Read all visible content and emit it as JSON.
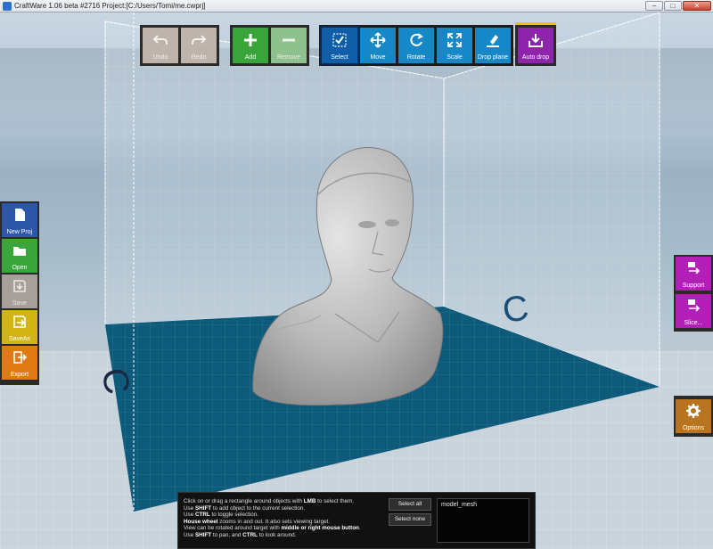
{
  "window": {
    "title": "CraftWare 1.06 beta #2716   Project:[C:/Users/Tomi/me.cwprj]",
    "min": "–",
    "max": "□",
    "close": "✕"
  },
  "toolbar": {
    "history": [
      {
        "label": "Undo",
        "icon": "undo-icon"
      },
      {
        "label": "Redo",
        "icon": "redo-icon"
      }
    ],
    "objects": [
      {
        "label": "Add",
        "icon": "plus-icon"
      },
      {
        "label": "Remove",
        "icon": "minus-icon"
      }
    ],
    "transform": [
      {
        "label": "Select",
        "icon": "select-check-icon",
        "active": true
      },
      {
        "label": "Move",
        "icon": "move-arrows-icon"
      },
      {
        "label": "Rotate",
        "icon": "rotate-icon"
      },
      {
        "label": "Scale",
        "icon": "scale-icon"
      },
      {
        "label": "Drop plane",
        "icon": "drop-plane-icon"
      }
    ],
    "auto_drop": {
      "label": "Auto drop",
      "icon": "auto-drop-icon"
    }
  },
  "left_panel": [
    {
      "label": "New Proj",
      "icon": "new-project-icon"
    },
    {
      "label": "Open",
      "icon": "folder-icon"
    },
    {
      "label": "Save",
      "icon": "save-icon"
    },
    {
      "label": "SaveAs",
      "icon": "save-as-icon"
    },
    {
      "label": "Export",
      "icon": "export-icon"
    }
  ],
  "right_panel": [
    {
      "label": "Support",
      "icon": "support-icon"
    },
    {
      "label": "Slice...",
      "icon": "slice-icon"
    }
  ],
  "options": {
    "label": "Options",
    "icon": "gear-icon"
  },
  "help": {
    "line1_pre": "Click on or drag a rectangle around objects with ",
    "line1_bold": "LMB",
    "line1_post": " to select them.",
    "line2_bold": "SHIFT",
    "line2_pre": "Use ",
    "line2_post": " to add object to the current selection.",
    "line3_pre": "Use ",
    "line3_bold": "CTRL",
    "line3_post": " to toggle selection.",
    "line4_bold": "House wheel",
    "line4_post": " zooms in and out. It also sets viewing target.",
    "line5_pre": "View can be rotated around target with ",
    "line5_bold": "middle or right mouse button",
    "line5_post": ".",
    "line6_pre": "Use ",
    "line6_bold": "SHIFT",
    "line6_mid": " to pan, and ",
    "line6_bold2": "CTRL",
    "line6_post": " to look around.",
    "select_all": "Select all",
    "select_none": "Select none",
    "objects": [
      "model_mesh"
    ]
  },
  "colors": {
    "floor": "#0e5a7a",
    "model": "#c9c9c9",
    "accent_blue": "#1688c8",
    "accent_green": "#39a43a",
    "accent_purple": "#8e24aa"
  }
}
